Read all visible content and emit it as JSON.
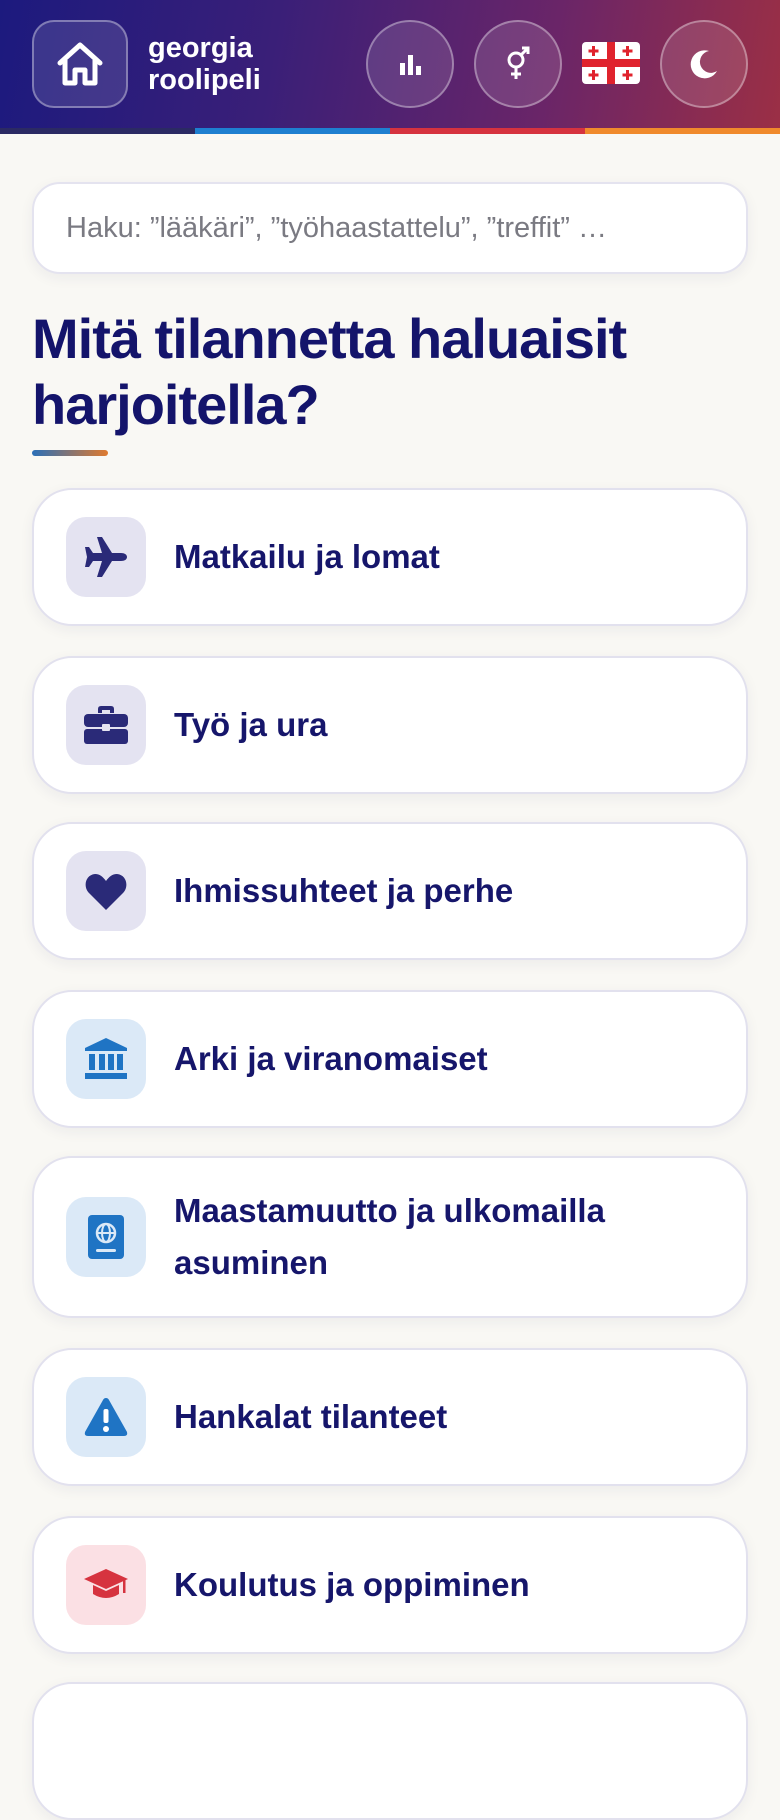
{
  "header": {
    "brand_line1": "georgia",
    "brand_line2": "roolipeli",
    "stripe_colors": [
      "#2b2a63",
      "#1e7fd0",
      "#d6333f",
      "#f08a2c"
    ]
  },
  "buttons": {
    "home_icon": "home-icon",
    "stats_icon": "bar-chart-icon",
    "gender_icon": "gender-icon",
    "flag": "georgia-flag",
    "theme_icon": "moon-icon"
  },
  "search": {
    "placeholder": "Haku: ”lääkäri”, ”työhaastattelu”, ”treffit” …"
  },
  "main": {
    "title": "Mitä tilannetta haluaisit harjoitella?"
  },
  "categories": [
    {
      "label": "Matkailu ja lomat",
      "icon": "airplane-icon",
      "icon_color": "#2a2a78",
      "bg": "#e4e3f1"
    },
    {
      "label": "Työ ja ura",
      "icon": "briefcase-icon",
      "icon_color": "#2a2a78",
      "bg": "#e4e3f1"
    },
    {
      "label": "Ihmissuhteet ja perhe",
      "icon": "heart-icon",
      "icon_color": "#2a2a78",
      "bg": "#e4e3f1"
    },
    {
      "label": "Arki ja viranomaiset",
      "icon": "bank-icon",
      "icon_color": "#1f74c4",
      "bg": "#dbe9f7"
    },
    {
      "label": "Maastamuutto ja ulkomailla asuminen",
      "icon": "passport-icon",
      "icon_color": "#1f74c4",
      "bg": "#dbe9f7"
    },
    {
      "label": "Hankalat tilanteet",
      "icon": "warning-icon",
      "icon_color": "#1f74c4",
      "bg": "#dbe9f7"
    },
    {
      "label": "Koulutus ja oppiminen",
      "icon": "graduation-cap-icon",
      "icon_color": "#d6333f",
      "bg": "#fbe0e4"
    }
  ]
}
